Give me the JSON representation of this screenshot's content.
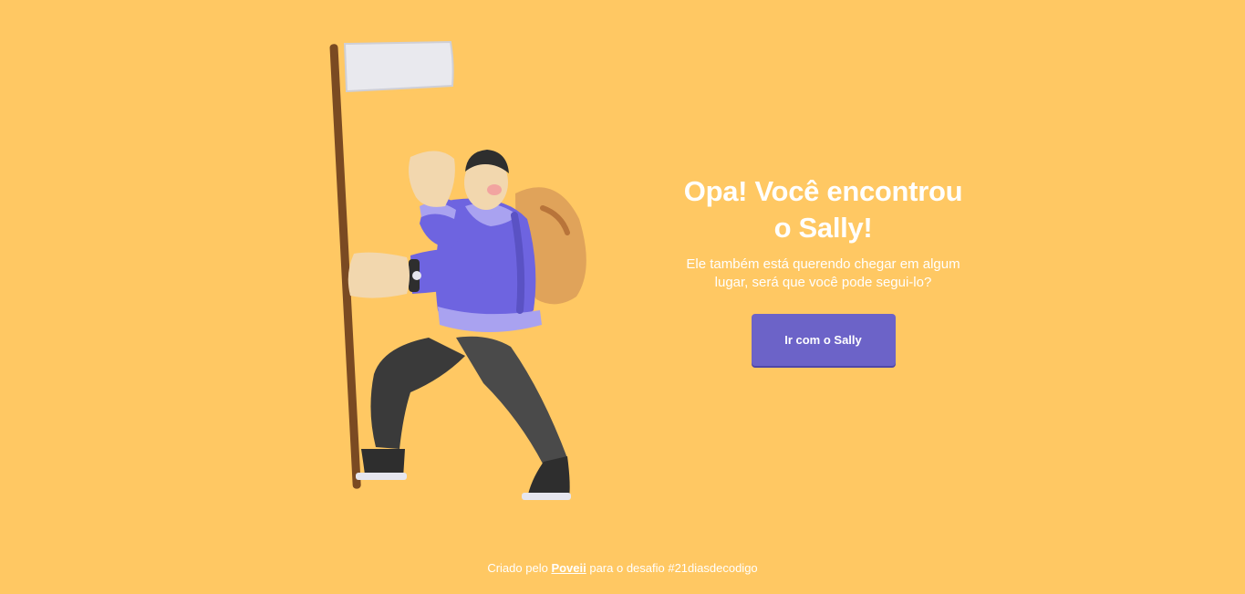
{
  "hero": {
    "title_line1": "Opa! Você encontrou",
    "title_line2": "o Sally!",
    "description": "Ele também está querendo chegar em algum lugar, será que você pode segui-lo?",
    "button_label": "Ir com o Sally"
  },
  "footer": {
    "prefix": "Criado pelo ",
    "author_link": "Poveii",
    "suffix": " para o desafio #21diasdecodigo"
  },
  "colors": {
    "background": "#FFC863",
    "button": "#6C63C8",
    "text": "#FFFFFF"
  },
  "illustration": {
    "subject": "hiker-with-flag-illustration"
  }
}
